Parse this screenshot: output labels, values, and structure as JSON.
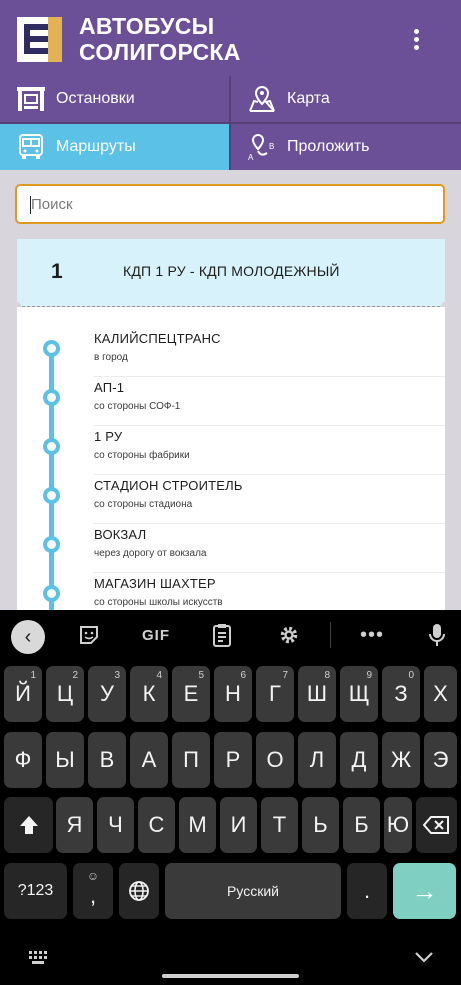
{
  "app": {
    "title_line1": "АВТОБУСЫ",
    "title_line2": "СОЛИГОРСКА",
    "menu_icon": "more-vert-icon",
    "colors": {
      "primary": "#6b5098",
      "accent": "#5bc1e6",
      "search_border": "#e09a1c",
      "card_header": "#d8f2fb"
    }
  },
  "nav": {
    "stops": {
      "label": "Остановки",
      "icon": "bus-stop-icon"
    },
    "map": {
      "label": "Карта",
      "icon": "map-pin-icon"
    },
    "routes": {
      "label": "Маршруты",
      "icon": "bus-front-icon"
    },
    "plan": {
      "label": "Проложить",
      "icon": "route-ab-icon"
    }
  },
  "search": {
    "placeholder": "Поиск",
    "value": ""
  },
  "route": {
    "number": "1",
    "name": "КДП 1 РУ - КДП МОЛОДЕЖНЫЙ",
    "stops": [
      {
        "name": "КАЛИЙСПЕЦТРАНС",
        "sub": "в город"
      },
      {
        "name": "АП-1",
        "sub": "со стороны СОФ-1"
      },
      {
        "name": "1 РУ",
        "sub": "со стороны фабрики"
      },
      {
        "name": "СТАДИОН СТРОИТЕЛЬ",
        "sub": "со стороны стадиона"
      },
      {
        "name": "ВОКЗАЛ",
        "sub": "через дорогу от вокзала"
      },
      {
        "name": "МАГАЗИН ШАХТЕР",
        "sub": "со стороны школы искусств"
      }
    ]
  },
  "keyboard": {
    "toolbar": {
      "gif_label": "GIF"
    },
    "row1": [
      {
        "k": "Й",
        "h": "1"
      },
      {
        "k": "Ц",
        "h": "2"
      },
      {
        "k": "У",
        "h": "3"
      },
      {
        "k": "К",
        "h": "4"
      },
      {
        "k": "Е",
        "h": "5"
      },
      {
        "k": "Н",
        "h": "6"
      },
      {
        "k": "Г",
        "h": "7"
      },
      {
        "k": "Ш",
        "h": "8"
      },
      {
        "k": "Щ",
        "h": "9"
      },
      {
        "k": "З",
        "h": "0"
      },
      {
        "k": "Х",
        "h": ""
      }
    ],
    "row2": [
      "Ф",
      "Ы",
      "В",
      "А",
      "П",
      "Р",
      "О",
      "Л",
      "Д",
      "Ж",
      "Э"
    ],
    "row3": [
      "Я",
      "Ч",
      "С",
      "М",
      "И",
      "Т",
      "Ь",
      "Б",
      "Ю"
    ],
    "symbols_label": "?123",
    "comma_label": ",",
    "comma_hint": "☺",
    "space_label": "Русский",
    "period_label": ".",
    "enter_label": "→"
  }
}
